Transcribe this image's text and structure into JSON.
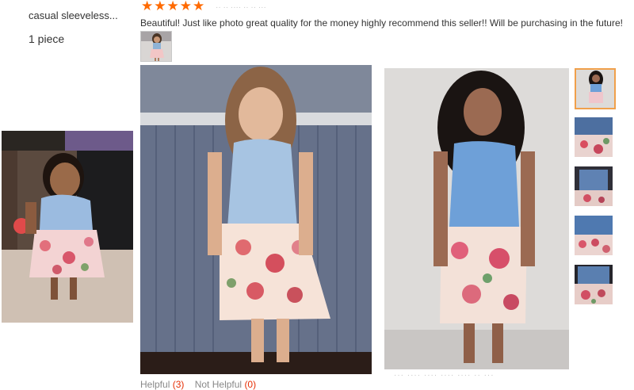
{
  "product": {
    "title": "casual sleeveless...",
    "quantity": "1 piece"
  },
  "review": {
    "rating": 5,
    "stars": [
      "★",
      "★",
      "★",
      "★",
      "★"
    ],
    "date_faded": "·· ·· ···· ·· ·· ···",
    "text": "Beautiful! Just like photo great quality for the money highly recommend this seller!! Will be purchasing in the future!",
    "helpful_label": "Helpful",
    "helpful_count": "(3)",
    "not_helpful_label": "Not Helpful",
    "not_helpful_count": "(0)"
  },
  "photos": {
    "thumbnail_count_side": 5,
    "active_side_thumb": 1
  },
  "footer_faded": "··· ···· ···· ····         ···· ·· ···",
  "colors": {
    "star": "#ff6a00",
    "active_thumb_border": "#f0a04b",
    "helpful_count": "#e62e04"
  }
}
